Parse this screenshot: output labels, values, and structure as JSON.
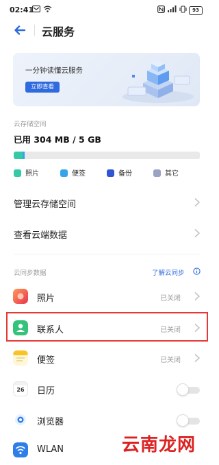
{
  "status_bar": {
    "time": "02:41",
    "battery": "93"
  },
  "header": {
    "title": "云服务"
  },
  "banner": {
    "text": "一分钟读懂云服务",
    "button": "立即查看"
  },
  "storage": {
    "section_label": "云存储空间",
    "used_text": "已用 304 MB / 5 GB",
    "used_fraction": 0.06,
    "legend": [
      {
        "label": "照片",
        "color": "#35c9a7"
      },
      {
        "label": "便签",
        "color": "#37a4e8"
      },
      {
        "label": "备份",
        "color": "#2f55d4"
      },
      {
        "label": "其它",
        "color": "#9aa3c4"
      }
    ]
  },
  "menu": [
    {
      "label": "管理云存储空间"
    },
    {
      "label": "查看云端数据"
    }
  ],
  "sync": {
    "section_label": "云同步数据",
    "learn_link": "了解云同步",
    "items": [
      {
        "label": "照片",
        "status": "已关闭",
        "icon": "photos-icon"
      },
      {
        "label": "联系人",
        "status": "已关闭",
        "icon": "contacts-icon"
      },
      {
        "label": "便签",
        "status": "已关闭",
        "icon": "notes-icon"
      },
      {
        "label": "日历",
        "status": "",
        "icon": "calendar-icon",
        "calendar_day": "26"
      },
      {
        "label": "浏览器",
        "status": "",
        "icon": "browser-icon"
      },
      {
        "label": "WLAN",
        "status": "",
        "icon": "wlan-icon"
      }
    ]
  },
  "watermark": "云南龙网",
  "colors": {
    "accent": "#2f6bde",
    "highlight": "#e53935"
  }
}
